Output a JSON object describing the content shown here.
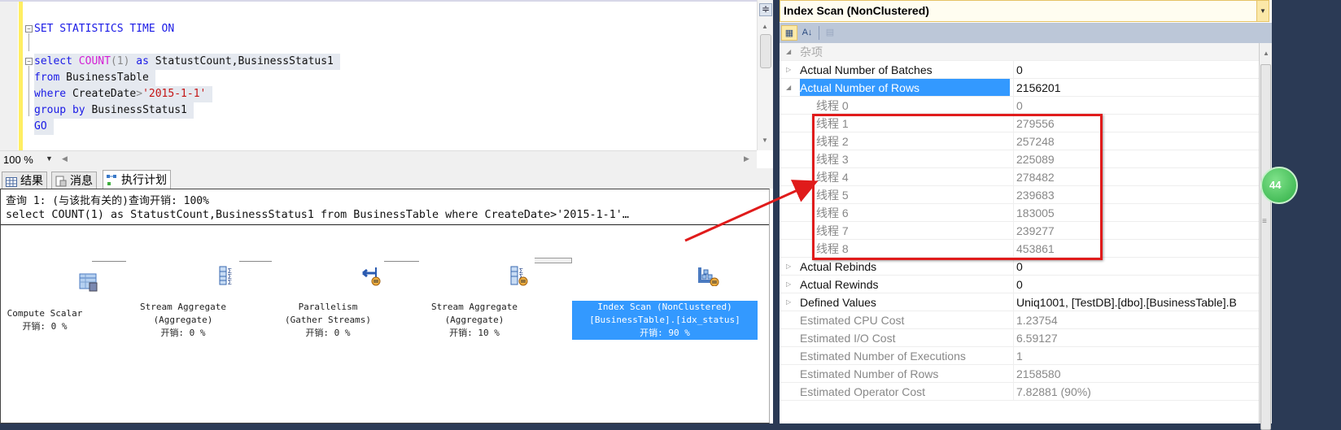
{
  "editor": {
    "lines": [
      {
        "tokens": [
          {
            "t": "SET STATISTICS TIME ON",
            "c": "kw"
          }
        ]
      },
      {
        "tokens": []
      },
      {
        "tokens": [
          {
            "t": "select ",
            "c": "kw"
          },
          {
            "t": "COUNT",
            "c": "fn"
          },
          {
            "t": "(1) ",
            "c": "op"
          },
          {
            "t": "as ",
            "c": "kw"
          },
          {
            "t": "StatustCount,BusinessStatus1",
            "c": "id"
          }
        ]
      },
      {
        "tokens": [
          {
            "t": "from ",
            "c": "kw"
          },
          {
            "t": "BusinessTable",
            "c": "id"
          }
        ]
      },
      {
        "tokens": [
          {
            "t": "where ",
            "c": "kw"
          },
          {
            "t": "CreateDate",
            "c": "id"
          },
          {
            "t": ">",
            "c": "op"
          },
          {
            "t": "'2015-1-1'",
            "c": "str"
          }
        ]
      },
      {
        "tokens": [
          {
            "t": "group by ",
            "c": "kw"
          },
          {
            "t": "BusinessStatus1",
            "c": "id"
          }
        ]
      },
      {
        "tokens": [
          {
            "t": "GO",
            "c": "kw"
          }
        ]
      }
    ],
    "zoom": "100 %"
  },
  "results_tabs": [
    {
      "label": "结果",
      "icon": "grid-icon",
      "active": false
    },
    {
      "label": "消息",
      "icon": "message-icon",
      "active": false
    },
    {
      "label": "执行计划",
      "icon": "execution-plan-icon",
      "active": true
    }
  ],
  "plan": {
    "header": "查询 1: (与该批有关的)查询开销: 100%",
    "statement": "select COUNT(1) as StatustCount,BusinessStatus1 from BusinessTable where CreateDate>'2015-1-1'…",
    "nodes": [
      {
        "name": "Compute Scalar",
        "sub": "",
        "cost": "开销: 0 %",
        "icon": "compute-scalar-icon"
      },
      {
        "name": "Stream Aggregate",
        "sub": "(Aggregate)",
        "cost": "开销: 0 %",
        "icon": "stream-aggregate-icon"
      },
      {
        "name": "Parallelism",
        "sub": "(Gather Streams)",
        "cost": "开销: 0 %",
        "icon": "parallelism-icon"
      },
      {
        "name": "Stream Aggregate",
        "sub": "(Aggregate)",
        "cost": "开销: 10 %",
        "icon": "stream-aggregate-parallel-icon"
      },
      {
        "name": "Index Scan (NonClustered)",
        "sub": "[BusinessTable].[idx_status]",
        "cost": "开销: 90 %",
        "icon": "index-scan-icon",
        "selected": true
      }
    ]
  },
  "properties": {
    "title": "Index Scan (NonClustered)",
    "category": "杂项",
    "rows": [
      {
        "name": "Actual Number of Batches",
        "value": "0",
        "style": "bold",
        "expander": "collapsed"
      },
      {
        "name": "Actual Number of Rows",
        "value": "2156201",
        "style": "bold",
        "expander": "expanded",
        "selected": true
      },
      {
        "name": "线程 0",
        "value": "0",
        "style": "dim sub"
      },
      {
        "name": "线程 1",
        "value": "279556",
        "style": "dim sub"
      },
      {
        "name": "线程 2",
        "value": "257248",
        "style": "dim sub"
      },
      {
        "name": "线程 3",
        "value": "225089",
        "style": "dim sub"
      },
      {
        "name": "线程 4",
        "value": "278482",
        "style": "dim sub"
      },
      {
        "name": "线程 5",
        "value": "239683",
        "style": "dim sub"
      },
      {
        "name": "线程 6",
        "value": "183005",
        "style": "dim sub"
      },
      {
        "name": "线程 7",
        "value": "239277",
        "style": "dim sub"
      },
      {
        "name": "线程 8",
        "value": "453861",
        "style": "dim sub"
      },
      {
        "name": "Actual Rebinds",
        "value": "0",
        "style": "bold",
        "expander": "collapsed"
      },
      {
        "name": "Actual Rewinds",
        "value": "0",
        "style": "bold",
        "expander": "collapsed"
      },
      {
        "name": "Defined Values",
        "value": "Uniq1001, [TestDB].[dbo].[BusinessTable].B",
        "style": "bold",
        "expander": "collapsed"
      },
      {
        "name": "Estimated CPU Cost",
        "value": "1.23754",
        "style": "dim"
      },
      {
        "name": "Estimated I/O Cost",
        "value": "6.59127",
        "style": "dim"
      },
      {
        "name": "Estimated Number of Executions",
        "value": "1",
        "style": "dim"
      },
      {
        "name": "Estimated Number of Rows",
        "value": "2158580",
        "style": "dim"
      },
      {
        "name": "Estimated Operator Cost",
        "value": "7.82881 (90%)",
        "style": "dim"
      }
    ]
  },
  "badge": "44",
  "colors": {
    "selection": "#3399ff",
    "annotation": "#e01b1b",
    "keyword": "#1a1ae6"
  }
}
